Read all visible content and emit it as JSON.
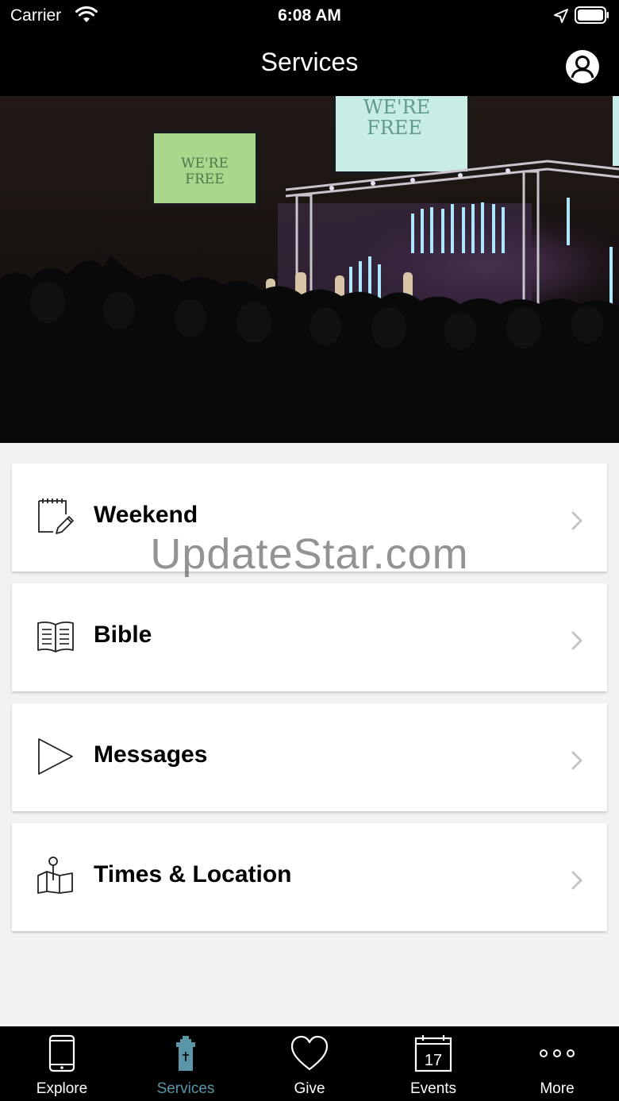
{
  "status_bar": {
    "carrier": "Carrier",
    "time": "6:08 AM"
  },
  "nav": {
    "title": "Services"
  },
  "hero": {
    "screen_text_left": [
      "WE'RE",
      "FREE"
    ],
    "screen_text_right": [
      "WE'RE",
      "FREE"
    ]
  },
  "menu": [
    {
      "label": "Weekend",
      "icon": "notepad-edit-icon"
    },
    {
      "label": "Bible",
      "icon": "open-book-icon"
    },
    {
      "label": "Messages",
      "icon": "play-icon"
    },
    {
      "label": "Times & Location",
      "icon": "map-pin-icon"
    }
  ],
  "watermark": "UpdateStar.com",
  "tabs": [
    {
      "label": "Explore",
      "icon": "phone-icon",
      "active": false
    },
    {
      "label": "Services",
      "icon": "church-icon",
      "active": true
    },
    {
      "label": "Give",
      "icon": "heart-icon",
      "active": false
    },
    {
      "label": "Events",
      "icon": "calendar-icon",
      "active": false,
      "icon_text": "17"
    },
    {
      "label": "More",
      "icon": "more-dots-icon",
      "active": false
    }
  ],
  "colors": {
    "accent": "#5b95a8",
    "bar": "#000000",
    "background": "#f2f2f2"
  }
}
